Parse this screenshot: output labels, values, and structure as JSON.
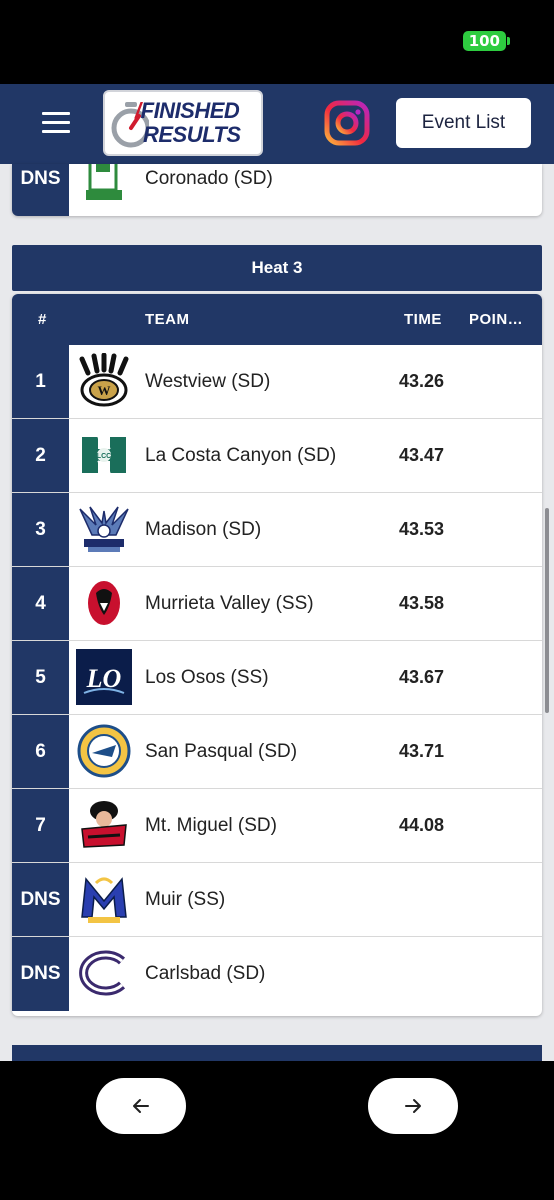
{
  "status": {
    "battery": "100"
  },
  "header": {
    "logo_line1": "FINISHED",
    "logo_line2": "RESULTS",
    "event_list_label": "Event List"
  },
  "previous_heat": {
    "last_row": {
      "place": "DNS",
      "team": "Coronado (SD)",
      "time": "",
      "logo": "coronado-logo"
    }
  },
  "heat": {
    "title": "Heat 3",
    "columns": {
      "place": "#",
      "team": "TEAM",
      "time": "TIME",
      "points": "POIN…"
    },
    "rows": [
      {
        "place": "1",
        "team": "Westview (SD)",
        "time": "43.26",
        "logo": "westview-logo"
      },
      {
        "place": "2",
        "team": "La Costa Canyon (SD)",
        "time": "43.47",
        "logo": "la-costa-canyon-logo"
      },
      {
        "place": "3",
        "team": "Madison (SD)",
        "time": "43.53",
        "logo": "madison-logo"
      },
      {
        "place": "4",
        "team": "Murrieta Valley (SS)",
        "time": "43.58",
        "logo": "murrieta-valley-logo"
      },
      {
        "place": "5",
        "team": "Los Osos (SS)",
        "time": "43.67",
        "logo": "los-osos-logo"
      },
      {
        "place": "6",
        "team": "San Pasqual (SD)",
        "time": "43.71",
        "logo": "san-pasqual-logo"
      },
      {
        "place": "7",
        "team": "Mt. Miguel (SD)",
        "time": "44.08",
        "logo": "mt-miguel-logo"
      },
      {
        "place": "DNS",
        "team": "Muir (SS)",
        "time": "",
        "logo": "muir-logo"
      },
      {
        "place": "DNS",
        "team": "Carlsbad (SD)",
        "time": "",
        "logo": "carlsbad-logo"
      }
    ]
  },
  "nav": {
    "back_icon": "arrow-left-icon",
    "forward_icon": "arrow-right-icon"
  },
  "colors": {
    "header_navy": "#213766",
    "battery_green": "#2ecc40"
  }
}
